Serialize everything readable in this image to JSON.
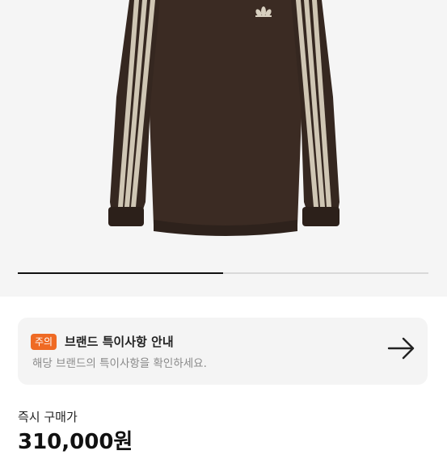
{
  "product_image": {
    "alt": "adidas brown velour long sleeve top"
  },
  "gallery": {
    "progress_fraction": 0.5
  },
  "notice": {
    "tag": "주의",
    "title": "브랜드 특이사항 안내",
    "description": "해당 브랜드의 특이사항을 확인하세요.",
    "icon": "arrow-right-icon"
  },
  "price": {
    "label": "즉시 구매가",
    "value": "310,000원"
  },
  "colors": {
    "accent": "#ef6a24",
    "garment": "#3a2a22",
    "stripe": "#c9c0ae"
  }
}
